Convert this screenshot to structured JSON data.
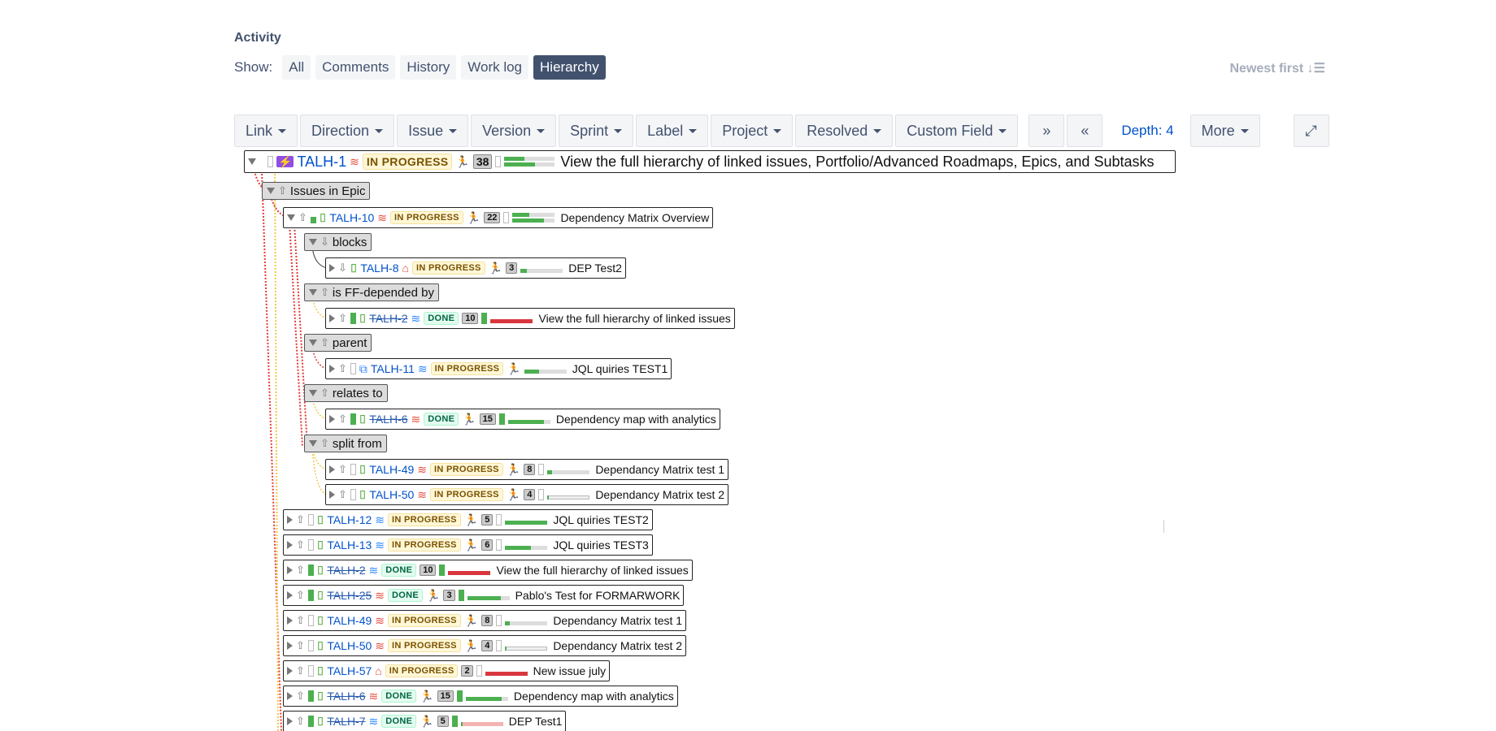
{
  "activity": {
    "heading": "Activity",
    "show_label": "Show:",
    "tabs": [
      "All",
      "Comments",
      "History",
      "Work log",
      "Hierarchy"
    ],
    "active_tab": "Hierarchy",
    "sort_label": "Newest first"
  },
  "toolbar": {
    "filters": [
      "Link",
      "Direction",
      "Issue",
      "Version",
      "Sprint",
      "Label",
      "Project",
      "Resolved",
      "Custom Field"
    ],
    "depth_label": "Depth: 4",
    "more_label": "More",
    "icons": [
      "expand-all-icon",
      "collapse-all-icon",
      "fullscreen-icon"
    ]
  },
  "root_issue": {
    "key": "TALH-1",
    "status": "IN PROGRESS",
    "count": "38",
    "summary": "View the full hierarchy of linked issues, Portfolio/Advanced Roadmaps, Epics, and Subtasks",
    "progress": [
      0.4,
      0.6
    ]
  },
  "groups": {
    "epic": "Issues in Epic",
    "blocks": "blocks",
    "ff": "is FF-depended by",
    "parent": "parent",
    "relates": "relates to",
    "split": "split from"
  },
  "talh10": {
    "key": "TALH-10",
    "status": "IN PROGRESS",
    "count": "22",
    "summary": "Dependency Matrix Overview"
  },
  "children": [
    {
      "key": "TALH-8",
      "status": "IN PROGRESS",
      "count": "3",
      "summary": "DEP Test2"
    },
    {
      "key": "TALH-2",
      "status": "DONE",
      "count": "10",
      "summary": "View the full hierarchy of linked issues"
    },
    {
      "key": "TALH-11",
      "status": "IN PROGRESS",
      "count": "",
      "summary": "JQL quiries TEST1"
    },
    {
      "key": "TALH-6",
      "status": "DONE",
      "count": "15",
      "summary": "Dependency map with analytics"
    },
    {
      "key": "TALH-49",
      "status": "IN PROGRESS",
      "count": "8",
      "summary": "Dependancy Matrix test 1"
    },
    {
      "key": "TALH-50",
      "status": "IN PROGRESS",
      "count": "4",
      "summary": "Dependancy Matrix test 2"
    }
  ],
  "epic_issues": [
    {
      "key": "TALH-12",
      "status": "IN PROGRESS",
      "count": "5",
      "summary": "JQL quiries TEST2"
    },
    {
      "key": "TALH-13",
      "status": "IN PROGRESS",
      "count": "6",
      "summary": "JQL quiries TEST3"
    },
    {
      "key": "TALH-2",
      "status": "DONE",
      "count": "10",
      "summary": "View the full hierarchy of linked issues"
    },
    {
      "key": "TALH-25",
      "status": "DONE",
      "count": "3",
      "summary": "Pablo's Test for FORMARWORK"
    },
    {
      "key": "TALH-49",
      "status": "IN PROGRESS",
      "count": "8",
      "summary": "Dependancy Matrix test 1"
    },
    {
      "key": "TALH-50",
      "status": "IN PROGRESS",
      "count": "4",
      "summary": "Dependancy Matrix test 2"
    },
    {
      "key": "TALH-57",
      "status": "IN PROGRESS",
      "count": "2",
      "summary": "New issue july"
    },
    {
      "key": "TALH-6",
      "status": "DONE",
      "count": "15",
      "summary": "Dependency map with analytics"
    },
    {
      "key": "TALH-7",
      "status": "DONE",
      "count": "5",
      "summary": "DEP Test1"
    }
  ]
}
